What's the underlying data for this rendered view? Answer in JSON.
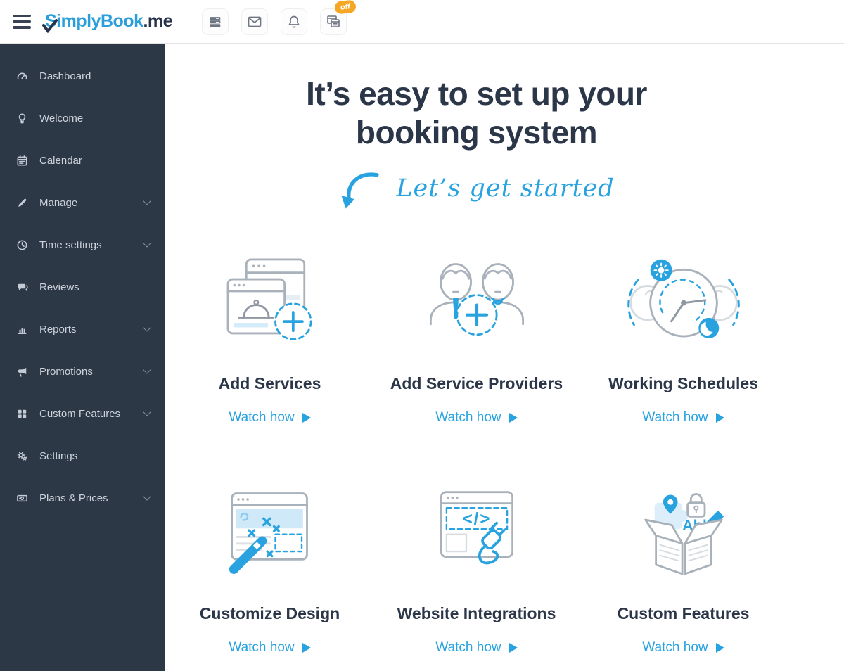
{
  "colors": {
    "accent": "#29a3e0",
    "sidebar_bg": "#2d3847",
    "heading_text": "#2b3648",
    "badge_bg": "#f5a623"
  },
  "header": {
    "logo_blue": "SimplyBook",
    "logo_dark": ".me",
    "badge": "off"
  },
  "sidebar": {
    "items": [
      {
        "label": "Dashboard",
        "icon": "dashboard-icon",
        "expandable": false
      },
      {
        "label": "Welcome",
        "icon": "lightbulb-icon",
        "expandable": false
      },
      {
        "label": "Calendar",
        "icon": "calendar-icon",
        "expandable": false
      },
      {
        "label": "Manage",
        "icon": "pencil-icon",
        "expandable": true
      },
      {
        "label": "Time settings",
        "icon": "clock-icon",
        "expandable": true
      },
      {
        "label": "Reviews",
        "icon": "chat-icon",
        "expandable": false
      },
      {
        "label": "Reports",
        "icon": "bar-chart-icon",
        "expandable": true
      },
      {
        "label": "Promotions",
        "icon": "megaphone-icon",
        "expandable": true
      },
      {
        "label": "Custom Features",
        "icon": "modules-icon",
        "expandable": true
      },
      {
        "label": "Settings",
        "icon": "gears-icon",
        "expandable": false
      },
      {
        "label": "Plans & Prices",
        "icon": "money-icon",
        "expandable": true
      }
    ]
  },
  "main": {
    "title_line1": "It’s easy to set up your",
    "title_line2": "booking system",
    "tagline": "Let’s get started",
    "cards": [
      {
        "title": "Add Services",
        "link_label": "Watch how"
      },
      {
        "title": "Add Service Providers",
        "link_label": "Watch how"
      },
      {
        "title": "Working Schedules",
        "link_label": "Watch how"
      },
      {
        "title": "Customize Design",
        "link_label": "Watch how"
      },
      {
        "title": "Website Integrations",
        "link_label": "Watch how"
      },
      {
        "title": "Custom Features",
        "link_label": "Watch how"
      }
    ]
  }
}
